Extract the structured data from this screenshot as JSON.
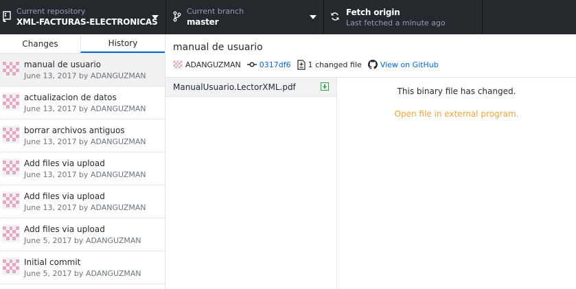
{
  "toolbar": {
    "repo": {
      "label": "Current repository",
      "value": "XML-FACTURAS-ELECTRONICAS"
    },
    "branch": {
      "label": "Current branch",
      "value": "master"
    },
    "fetch": {
      "label": "Fetch origin",
      "status": "Last fetched a minute ago"
    }
  },
  "sidebar": {
    "tabs": [
      {
        "label": "Changes"
      },
      {
        "label": "History"
      }
    ],
    "active_tab": "History",
    "commits": [
      {
        "title": "manual de usuario",
        "meta": "June 13, 2017 by ADANGUZMAN"
      },
      {
        "title": "actualizacion de datos",
        "meta": "June 13, 2017 by ADANGUZMAN"
      },
      {
        "title": "borrar archivos antiguos",
        "meta": "June 13, 2017 by ADANGUZMAN"
      },
      {
        "title": "Add files via upload",
        "meta": "June 13, 2017 by ADANGUZMAN"
      },
      {
        "title": "Add files via upload",
        "meta": "June 13, 2017 by ADANGUZMAN"
      },
      {
        "title": "Add files via upload",
        "meta": "June 5, 2017 by ADANGUZMAN"
      },
      {
        "title": "Initial commit",
        "meta": "June 5, 2017 by ADANGUZMAN"
      }
    ]
  },
  "commit": {
    "title": "manual de usuario",
    "author": "ADANGUZMAN",
    "sha": "0317df6",
    "changed_files": "1 changed file",
    "view_on_github": "View on GitHub"
  },
  "files": [
    {
      "name": "ManualUsuario.LectorXML.pdf",
      "status": "added"
    }
  ],
  "diff": {
    "message": "This binary file has changed.",
    "open_external": "Open file in external program."
  },
  "colors": {
    "toolbar_bg": "#24292e",
    "accent": "#0366d6",
    "added": "#28a745",
    "link_orange": "#f0a33c",
    "avatar_pink": "#e8a7c3"
  }
}
